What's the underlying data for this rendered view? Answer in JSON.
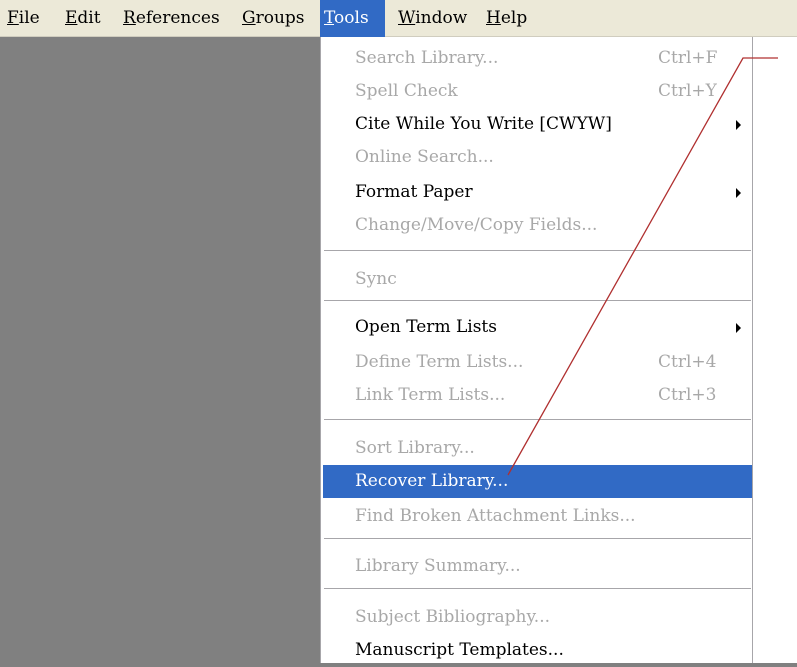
{
  "menubar": {
    "items": [
      {
        "pre": "",
        "ul": "F",
        "post": "ile"
      },
      {
        "pre": "",
        "ul": "E",
        "post": "dit"
      },
      {
        "pre": "",
        "ul": "R",
        "post": "eferences"
      },
      {
        "pre": "",
        "ul": "G",
        "post": "roups"
      },
      {
        "pre": "",
        "ul": "T",
        "post": "ools"
      },
      {
        "pre": "",
        "ul": "W",
        "post": "indow"
      },
      {
        "pre": "",
        "ul": "H",
        "post": "elp"
      }
    ]
  },
  "menu": {
    "items": [
      {
        "label": "Search Library...",
        "shortcut": "Ctrl+F"
      },
      {
        "label": "Spell Check",
        "shortcut": "Ctrl+Y"
      },
      {
        "label": "Cite While You Write [CWYW]"
      },
      {
        "label": "Online Search..."
      },
      {
        "label": "Format Paper"
      },
      {
        "label": "Change/Move/Copy Fields..."
      },
      {
        "label": "Sync"
      },
      {
        "label": "Open Term Lists"
      },
      {
        "label": "Define Term Lists...",
        "shortcut": "Ctrl+4"
      },
      {
        "label": "Link Term Lists...",
        "shortcut": "Ctrl+3"
      },
      {
        "label": "Sort Library..."
      },
      {
        "label": "Recover Library..."
      },
      {
        "label": "Find Broken Attachment Links..."
      },
      {
        "label": "Library Summary..."
      },
      {
        "label": "Subject Bibliography..."
      },
      {
        "label": "Manuscript Templates..."
      }
    ]
  },
  "colors": {
    "highlight": "#316ac5",
    "disabled_text": "#a8a8a8",
    "annotation_line": "#b03030",
    "background": "#808080",
    "menubar": "#ece9d8"
  }
}
